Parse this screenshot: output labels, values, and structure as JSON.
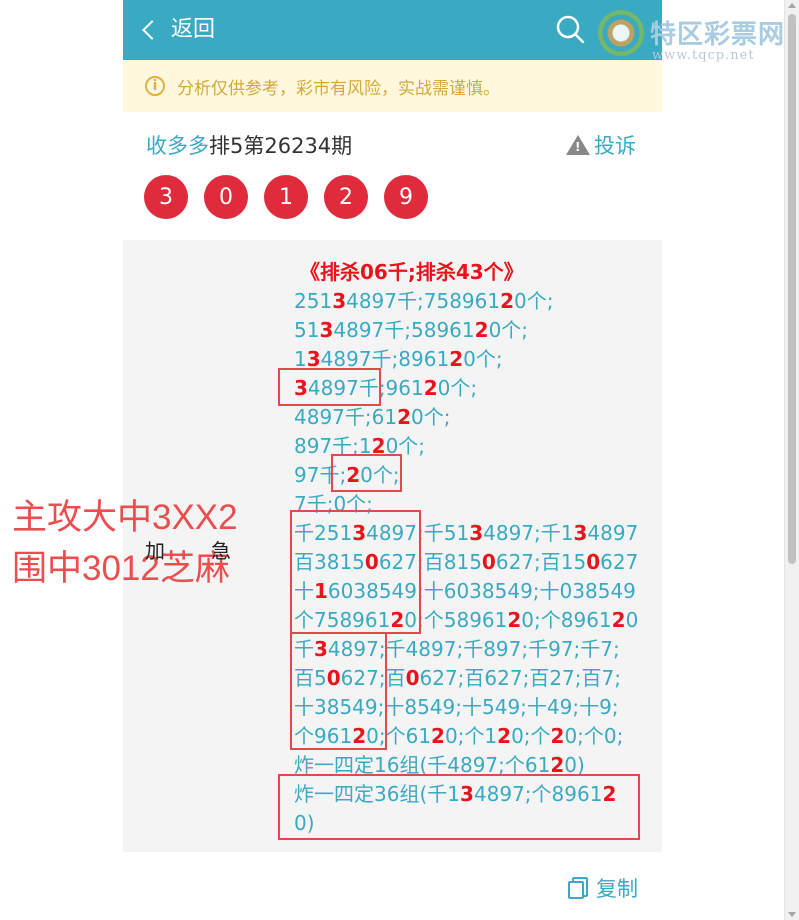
{
  "header": {
    "back_label": "返回"
  },
  "logo": {
    "name": "特区彩票网",
    "url": "www.tqcp.net"
  },
  "notice": {
    "text": "分析仅供参考，彩市有风险，实战需谨慎。"
  },
  "post": {
    "author": "收多多",
    "title": "排5第26234期",
    "report_label": "投诉"
  },
  "balls": [
    "3",
    "0",
    "1",
    "2",
    "9"
  ],
  "analysis": {
    "heading": "《排杀06千;排杀43个》",
    "lines": [
      [
        [
          "251",
          0
        ],
        [
          "3",
          1
        ],
        [
          "4897千;758961",
          0
        ],
        [
          "2",
          1
        ],
        [
          "0个;",
          0
        ]
      ],
      [
        [
          "51",
          0
        ],
        [
          "3",
          1
        ],
        [
          "4897千;58961",
          0
        ],
        [
          "2",
          1
        ],
        [
          "0个;",
          0
        ]
      ],
      [
        [
          "1",
          0
        ],
        [
          "3",
          1
        ],
        [
          "4897千;8961",
          0
        ],
        [
          "2",
          1
        ],
        [
          "0个;",
          0
        ]
      ],
      [
        [
          "3",
          1
        ],
        [
          "4897千;961",
          0
        ],
        [
          "2",
          1
        ],
        [
          "0个;",
          0
        ]
      ],
      [
        [
          "4897千;61",
          0
        ],
        [
          "2",
          1
        ],
        [
          "0个;",
          0
        ]
      ],
      [
        [
          "897千;1",
          0
        ],
        [
          "2",
          1
        ],
        [
          "0个;",
          0
        ]
      ],
      [
        [
          "97千;",
          0
        ],
        [
          "2",
          1
        ],
        [
          "0个;",
          0
        ]
      ],
      [
        [
          "7千;0个;",
          0
        ]
      ],
      [
        [
          "千251",
          0
        ],
        [
          "3",
          1
        ],
        [
          "4897;千51",
          0
        ],
        [
          "3",
          1
        ],
        [
          "4897;千1",
          0
        ],
        [
          "3",
          1
        ],
        [
          "4897",
          0
        ]
      ],
      [
        [
          "百3815",
          0
        ],
        [
          "0",
          1
        ],
        [
          "627;百815",
          0
        ],
        [
          "0",
          1
        ],
        [
          "627;百15",
          0
        ],
        [
          "0",
          1
        ],
        [
          "627",
          0
        ]
      ],
      [
        [
          "十",
          0
        ],
        [
          "1",
          1
        ],
        [
          "6038549;十6038549;十038549",
          0
        ]
      ],
      [
        [
          "个758961",
          0
        ],
        [
          "2",
          1
        ],
        [
          "0;个58961",
          0
        ],
        [
          "2",
          1
        ],
        [
          "0;个8961",
          0
        ],
        [
          "2",
          1
        ],
        [
          "0",
          0
        ]
      ],
      [
        [
          "千",
          0
        ],
        [
          "3",
          1
        ],
        [
          "4897;千4897;千897;千97;千7;",
          0
        ]
      ],
      [
        [
          "百5",
          0
        ],
        [
          "0",
          1
        ],
        [
          "627;百",
          0
        ],
        [
          "0",
          1
        ],
        [
          "627;百627;百27;百7;",
          0
        ]
      ],
      [
        [
          "十38549;十8549;十549;十49;十9;",
          0
        ]
      ],
      [
        [
          "个961",
          0
        ],
        [
          "2",
          1
        ],
        [
          "0;个61",
          0
        ],
        [
          "2",
          1
        ],
        [
          "0;个1",
          0
        ],
        [
          "2",
          1
        ],
        [
          "0;个",
          0
        ],
        [
          "2",
          1
        ],
        [
          "0;个0;",
          0
        ]
      ],
      [
        [
          "炸一四定16组(千4897;个61",
          0
        ],
        [
          "2",
          1
        ],
        [
          "0)",
          0
        ]
      ],
      [
        [
          "炸一四定36组(千1",
          0
        ],
        [
          "3",
          1
        ],
        [
          "4897;个8961",
          0
        ],
        [
          "2",
          1
        ]
      ],
      [
        [
          "0)",
          0
        ]
      ]
    ]
  },
  "annotation": {
    "line1": "主攻大中3XX2",
    "line2": "围中3012芝麻",
    "small_left": "加",
    "small_right": "急"
  },
  "footer": {
    "copy_label": "复制"
  },
  "colors": {
    "accent": "#3aa9c2",
    "ball": "#e02b3d",
    "highlight": "#e8141b",
    "annotation": "#ec4e50"
  }
}
